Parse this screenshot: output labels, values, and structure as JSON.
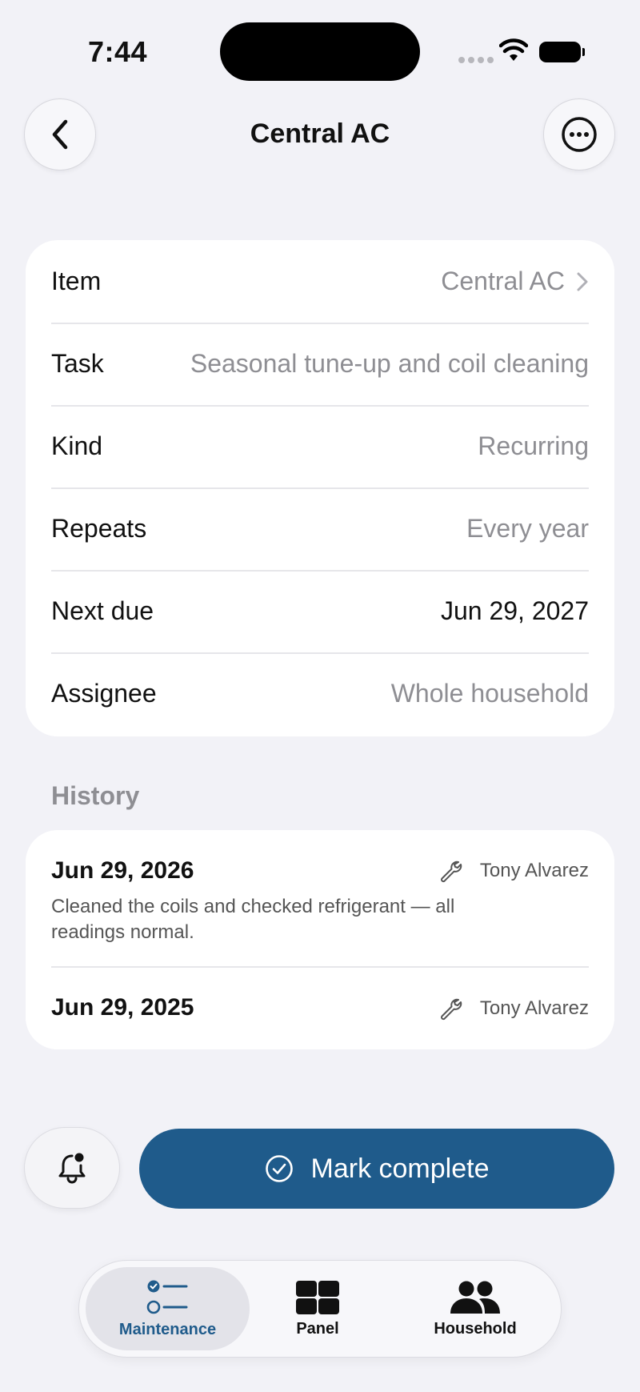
{
  "status": {
    "time": "7:44"
  },
  "nav": {
    "title": "Central AC"
  },
  "details": [
    {
      "label": "Item",
      "value": "Central AC",
      "muted": true,
      "chevron": true
    },
    {
      "label": "Task",
      "value": "Seasonal tune-up and coil cleaning",
      "muted": true
    },
    {
      "label": "Kind",
      "value": "Recurring",
      "muted": true
    },
    {
      "label": "Repeats",
      "value": "Every year",
      "muted": true
    },
    {
      "label": "Next due",
      "value": "Jun 29, 2027",
      "muted": false
    },
    {
      "label": "Assignee",
      "value": "Whole household",
      "muted": true
    }
  ],
  "history": {
    "title": "History",
    "entries": [
      {
        "date": "Jun 29, 2026",
        "person": "Tony Alvarez",
        "note": "Cleaned the coils and checked refrigerant — all readings normal."
      },
      {
        "date": "Jun 29, 2025",
        "person": "Tony Alvarez"
      }
    ]
  },
  "actions": {
    "complete_label": "Mark complete"
  },
  "tabs": [
    {
      "label": "Maintenance",
      "icon": "checklist-icon",
      "active": true
    },
    {
      "label": "Panel",
      "icon": "grid-icon"
    },
    {
      "label": "Household",
      "icon": "people-icon"
    }
  ],
  "colors": {
    "accent": "#1f5b8b",
    "background": "#f2f2f7",
    "muted_text": "#8e8e93"
  }
}
